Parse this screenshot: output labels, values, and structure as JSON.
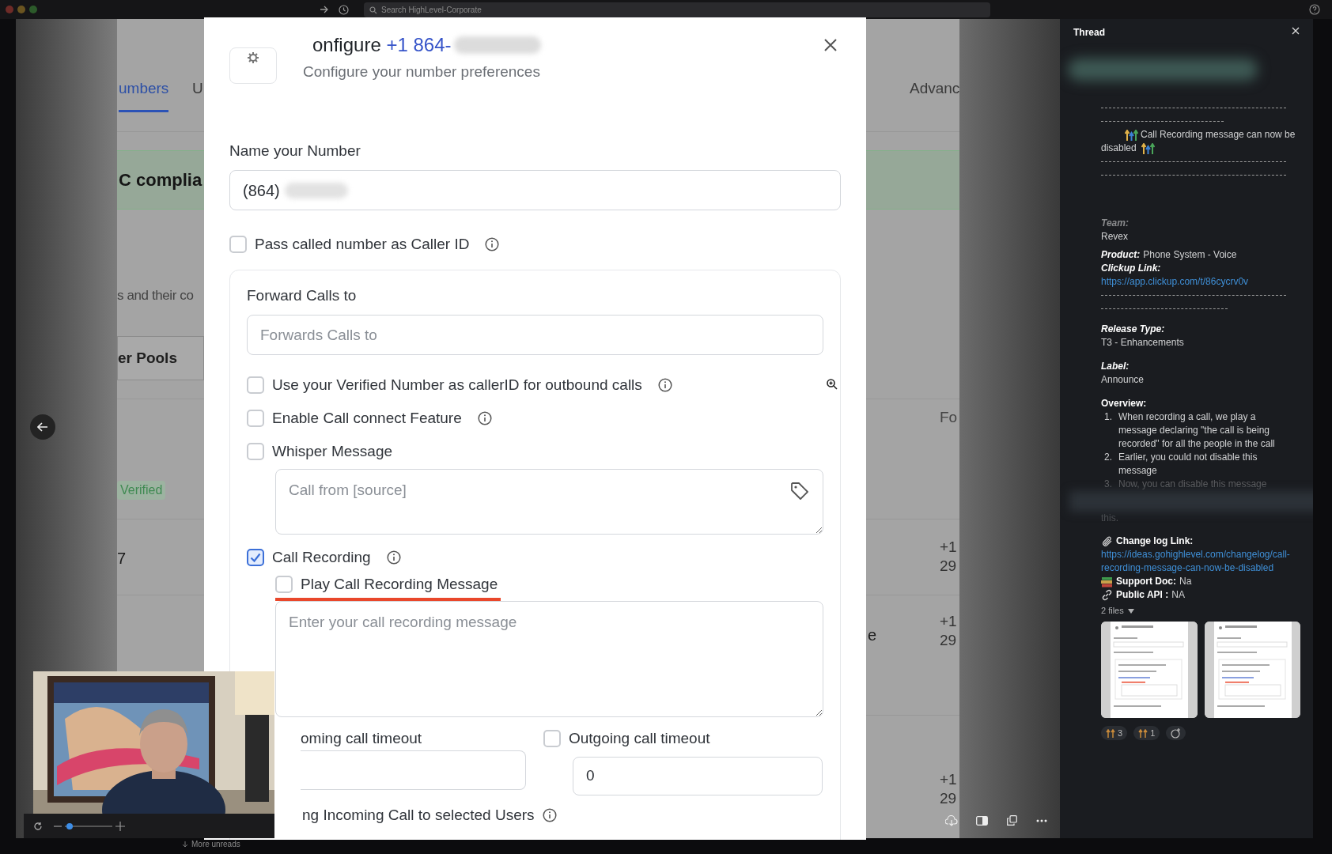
{
  "top_bar": {
    "search_placeholder": "Search HighLevel-Corporate"
  },
  "background_page": {
    "tabs": [
      {
        "label": "umbers",
        "selected": true
      },
      {
        "label": "U",
        "selected": false
      },
      {
        "label": "Advanc",
        "selected": false
      }
    ],
    "banner": "C complia",
    "description": "s and their co",
    "pool_tab": "er Pools",
    "status": "Verified",
    "row_number": "7",
    "column_header": "Fo",
    "row_text": "e",
    "numbers": [
      {
        "line1": "+1",
        "line2": "29"
      },
      {
        "line1": "+1",
        "line2": "29"
      },
      {
        "line1": "+1",
        "line2": "29"
      }
    ]
  },
  "modal": {
    "title_prefix": "onfigure",
    "title_number": "+1 864-",
    "subtitle": "Configure your number preferences",
    "name_label": "Name your Number",
    "name_value": "(864)",
    "pass_caller_id": {
      "label": "Pass called number as Caller ID",
      "checked": false
    },
    "forward": {
      "title": "Forward Calls to",
      "placeholder": "Forwards Calls to",
      "options": [
        {
          "kind": "checkbox",
          "label": "Use your Verified Number as callerID for outbound calls",
          "checked": false,
          "info": true
        },
        {
          "kind": "checkbox",
          "label": "Enable Call connect Feature",
          "checked": false,
          "info": true
        },
        {
          "kind": "checkbox",
          "label": "Whisper Message",
          "checked": false,
          "info": false
        },
        {
          "kind": "textarea",
          "placeholder": "Call from [source]",
          "tag_button": true
        },
        {
          "kind": "checkbox",
          "label": "Call Recording",
          "checked": true,
          "info": true
        },
        {
          "kind": "sub_checkbox",
          "label": "Play Call Recording Message",
          "checked": false,
          "highlighted": true
        },
        {
          "kind": "textarea",
          "placeholder": "Enter your call recording message",
          "tag_button": false
        }
      ]
    },
    "incoming_timeout": {
      "label": "oming call timeout"
    },
    "outgoing_timeout": {
      "label": "Outgoing call timeout",
      "checked": false,
      "value": "0"
    },
    "ring_users": {
      "label": "ng Incoming Call to selected Users",
      "info": true
    }
  },
  "video_controls": {
    "zoom": {
      "level": 0.1
    }
  },
  "status_text": "More unreads",
  "thread": {
    "title": "Thread",
    "headline_start": "Call Recording message can now be",
    "headline_end": "disabled",
    "team_label": "Team:",
    "team": "Revex",
    "product_label": "Product:",
    "product": "Phone System - Voice",
    "clickup_label": "Clickup Link:",
    "clickup_url": "https://app.clickup.com/t/86cycrv0v",
    "release_label": "Release Type:",
    "release": "T3 - Enhancements",
    "label_label": "Label:",
    "label": "Announce",
    "overview_label": "Overview:",
    "overview": [
      {
        "marker": "1.",
        "text": "When recording a call, we play a message declaring \"the call is being recorded\" for all the people in the call",
        "faded": false
      },
      {
        "marker": "2.",
        "text": "Earlier, you could not disable this message",
        "faded": false
      },
      {
        "marker": "3.",
        "text": "Now, you can disable this message",
        "faded": true
      }
    ],
    "overview_tail": "this.",
    "changelog_label": "Change log Link:",
    "changelog_url": "https://ideas.gohighlevel.com/changelog/call-recording-message-can-now-be-disabled",
    "support_label": "Support Doc:",
    "support": "Na",
    "api_label": "Public API :",
    "api": "NA",
    "files": "2 files",
    "attachments": [
      {
        "kind": "screenshot"
      },
      {
        "kind": "screenshot"
      }
    ],
    "reactions": [
      {
        "count": "3"
      },
      {
        "count": "1"
      }
    ]
  }
}
